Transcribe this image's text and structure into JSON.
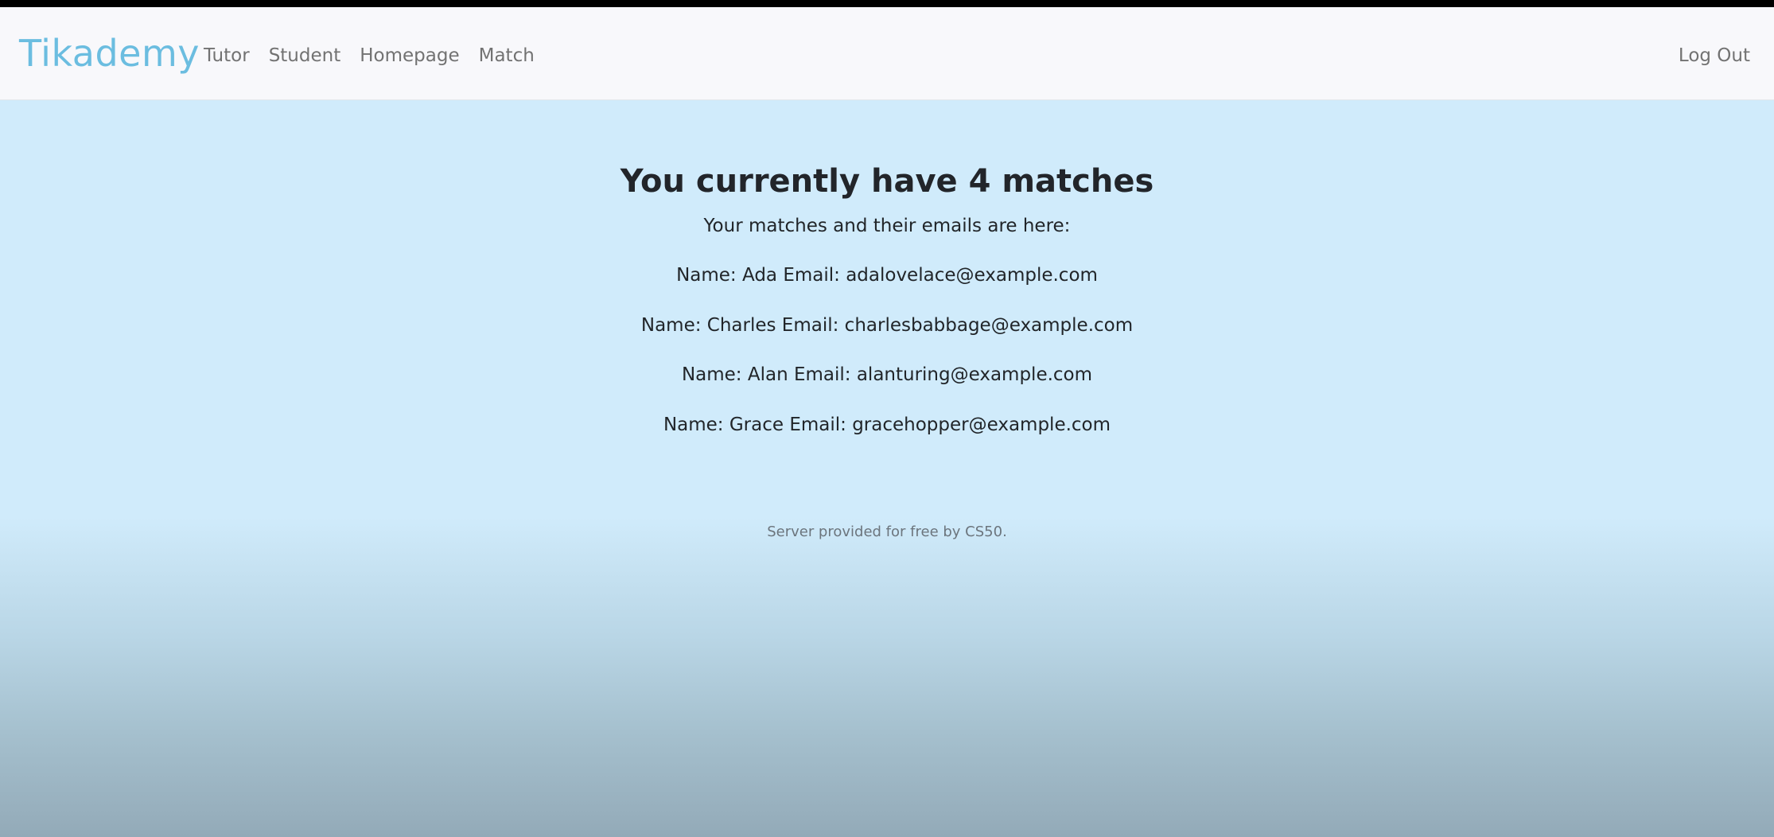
{
  "navbar": {
    "brand": "Tikademy",
    "links": [
      {
        "label": "Tutor"
      },
      {
        "label": "Student"
      },
      {
        "label": "Homepage"
      },
      {
        "label": "Match"
      }
    ],
    "logout_label": "Log Out"
  },
  "main": {
    "heading": "You currently have 4 matches",
    "subtitle": "Your matches and their emails are here:",
    "matches": [
      {
        "text": "Name: Ada Email: adalovelace@example.com"
      },
      {
        "text": "Name: Charles Email: charlesbabbage@example.com"
      },
      {
        "text": "Name: Alan Email: alanturing@example.com"
      },
      {
        "text": "Name: Grace Email: gracehopper@example.com"
      }
    ]
  },
  "footer": {
    "text": "Server provided for free by CS50."
  },
  "colors": {
    "brand": "#6bbde0",
    "background": "#d0ebfb",
    "navbar": "#f8f8fb",
    "nav_link": "#727272"
  }
}
